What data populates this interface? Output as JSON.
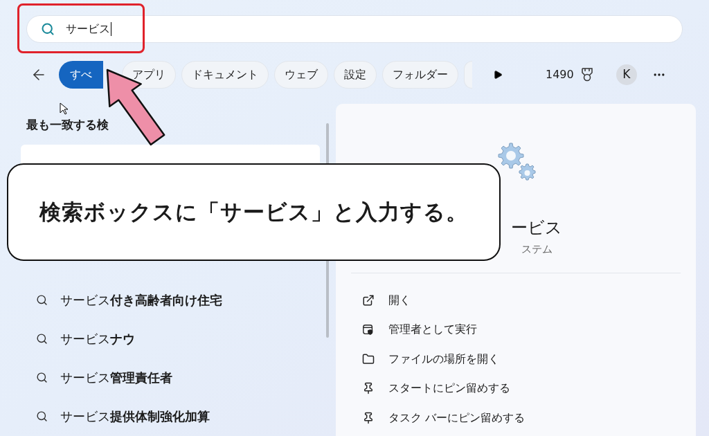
{
  "search": {
    "value": "サービス"
  },
  "filters": [
    {
      "label": "すべ",
      "selected": true
    },
    {
      "label": "アプリ",
      "selected": false
    },
    {
      "label": "ドキュメント",
      "selected": false
    },
    {
      "label": "ウェブ",
      "selected": false
    },
    {
      "label": "設定",
      "selected": false
    },
    {
      "label": "フォルダー",
      "selected": false
    }
  ],
  "points": "1490",
  "avatar": "K",
  "results": {
    "heading": "最も一致する検",
    "suggestions": [
      "サービス**付き高齢者向け住宅**",
      "サービス**ナウ**",
      "サービス**管理責任者**",
      "サービス**提供体制強化加算**"
    ]
  },
  "detail": {
    "title": "ービス",
    "subtitle": "ステム",
    "actions": [
      {
        "kind": "open",
        "label": "開く"
      },
      {
        "kind": "admin",
        "label": "管理者として実行"
      },
      {
        "kind": "folder",
        "label": "ファイルの場所を開く"
      },
      {
        "kind": "pin",
        "label": "スタートにピン留めする"
      },
      {
        "kind": "pin",
        "label": "タスク バーにピン留めする"
      }
    ]
  },
  "caption": "検索ボックスに「サービス」と入力する。"
}
